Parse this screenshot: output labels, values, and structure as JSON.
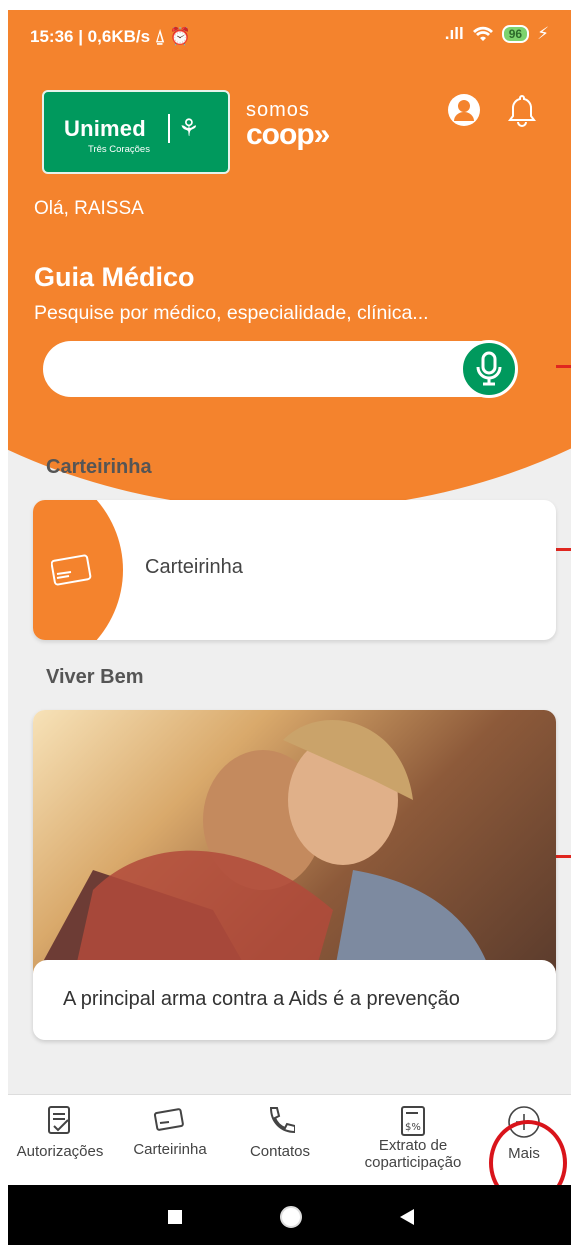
{
  "status_bar": {
    "time": "15:36 | 0,6KB/s",
    "notif_icons": "⍙ ⏰",
    "signal": ".ıll",
    "battery": "96",
    "charging": "⚡"
  },
  "header": {
    "brand_name": "Unimed",
    "brand_sub": "Três Corações",
    "coop_line1": "somos",
    "coop_line2": "coop»",
    "greeting": "Olá, RAISSA"
  },
  "guide": {
    "title": "Guia Médico",
    "subtitle": "Pesquise por médico, especialidade, clínica...",
    "search_value": ""
  },
  "sections": {
    "card_section_title": "Carteirinha",
    "card_label": "Carteirinha",
    "live_well_title": "Viver Bem",
    "news_caption": "A principal arma contra a Aids é a prevenção"
  },
  "nav": {
    "items": [
      {
        "label": "Autorizações"
      },
      {
        "label": "Carteirinha"
      },
      {
        "label": "Contatos"
      },
      {
        "label": "Extrato de coparticipação"
      },
      {
        "label": "Mais"
      }
    ]
  },
  "colors": {
    "accent": "#f4832d",
    "brand_green": "#00995d",
    "highlight": "#d9141b"
  }
}
